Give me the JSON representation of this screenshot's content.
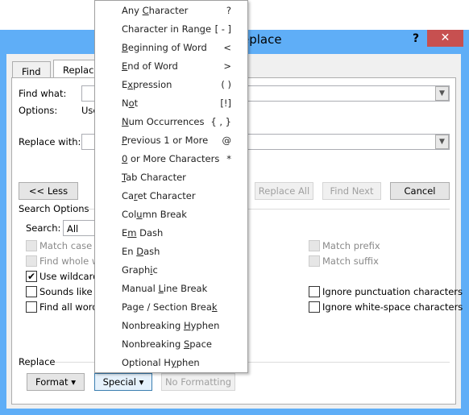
{
  "window": {
    "title": "Find and Replace",
    "visible_title": "eplace",
    "help": "?",
    "close": "✕",
    "accent": "#5faef7",
    "close_color": "#c75050"
  },
  "tabs": [
    {
      "label": "Find"
    },
    {
      "label": "Replace"
    }
  ],
  "find": {
    "label": "Find what:",
    "value": "",
    "options_label": "Options:",
    "options_value": "Use Wildcards"
  },
  "replace": {
    "label": "Replace with:",
    "value": ""
  },
  "buttons": {
    "less": "<< Less",
    "replace_all": "Replace All",
    "find_next": "Find Next",
    "cancel": "Cancel"
  },
  "search_options": {
    "heading": "Search Options",
    "search_label": "Search:",
    "search_value": "All",
    "left": [
      {
        "label": "Match case",
        "checked": false,
        "disabled": true
      },
      {
        "label": "Find whole words only",
        "checked": false,
        "disabled": true
      },
      {
        "label": "Use wildcards",
        "checked": true,
        "disabled": false
      },
      {
        "label": "Sounds like (English)",
        "checked": false,
        "disabled": false
      },
      {
        "label": "Find all word forms (English)",
        "checked": false,
        "disabled": false
      }
    ],
    "right": [
      {
        "label": "Match prefix",
        "checked": false,
        "disabled": true
      },
      {
        "label": "Match suffix",
        "checked": false,
        "disabled": true
      },
      {
        "label": "Ignore punctuation characters",
        "checked": false,
        "disabled": false
      },
      {
        "label": "Ignore white-space characters",
        "checked": false,
        "disabled": false
      }
    ]
  },
  "replace_section": {
    "heading": "Replace",
    "format": "Format ▾",
    "special": "Special ▾",
    "no_formatting": "No Formatting"
  },
  "special_menu": [
    {
      "label": "Any Character",
      "symbol": "?",
      "u": 4
    },
    {
      "label": "Character in Range",
      "symbol": "[ - ]",
      "u": 16
    },
    {
      "label": "Beginning of Word",
      "symbol": "<",
      "u": 0
    },
    {
      "label": "End of Word",
      "symbol": ">",
      "u": 0
    },
    {
      "label": "Expression",
      "symbol": "( )",
      "u": 1
    },
    {
      "label": "Not",
      "symbol": "[!]",
      "u": 1
    },
    {
      "label": "Num Occurrences",
      "symbol": "{ , }",
      "u": 0
    },
    {
      "label": "Previous 1 or More",
      "symbol": "@",
      "u": 0
    },
    {
      "label": "0 or More Characters",
      "symbol": "*",
      "u": 0
    },
    {
      "label": "Tab Character",
      "symbol": "",
      "u": 0
    },
    {
      "label": "Caret Character",
      "symbol": "",
      "u": 2
    },
    {
      "label": "Column Break",
      "symbol": "",
      "u": 3
    },
    {
      "label": "Em Dash",
      "symbol": "",
      "u": 1
    },
    {
      "label": "En Dash",
      "symbol": "",
      "u": 3
    },
    {
      "label": "Graphic",
      "symbol": "",
      "u": 5
    },
    {
      "label": "Manual Line Break",
      "symbol": "",
      "u": 7
    },
    {
      "label": "Page / Section Break",
      "symbol": "",
      "u": 19
    },
    {
      "label": "Nonbreaking Hyphen",
      "symbol": "",
      "u": 12
    },
    {
      "label": "Nonbreaking Space",
      "symbol": "",
      "u": 12
    },
    {
      "label": "Optional Hyphen",
      "symbol": "",
      "u": 10
    }
  ]
}
